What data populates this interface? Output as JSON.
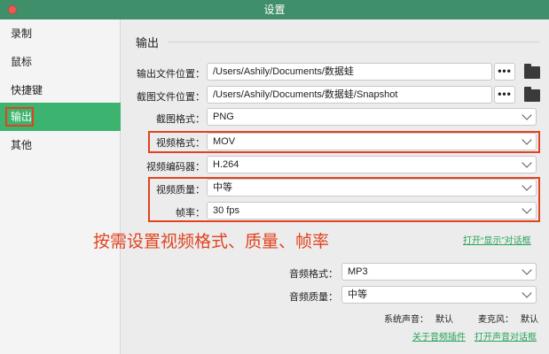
{
  "window": {
    "title": "设置"
  },
  "sidebar": {
    "items": [
      {
        "label": "录制"
      },
      {
        "label": "鼠标"
      },
      {
        "label": "快捷键"
      },
      {
        "label": "输出",
        "active": true
      },
      {
        "label": "其他"
      }
    ]
  },
  "main": {
    "section_title": "输出",
    "output_path": {
      "label": "输出文件位置：",
      "value": "/Users/Ashily/Documents/数据蛙",
      "browse": "•••"
    },
    "screenshot_path": {
      "label": "截图文件位置：",
      "value": "/Users/Ashily/Documents/数据蛙/Snapshot",
      "browse": "•••"
    },
    "screenshot_format": {
      "label": "截图格式：",
      "value": "PNG"
    },
    "video_format": {
      "label": "视频格式：",
      "value": "MOV"
    },
    "video_codec": {
      "label": "视频编码器：",
      "value": "H.264"
    },
    "video_quality": {
      "label": "视频质量：",
      "value": "中等"
    },
    "frame_rate": {
      "label": "帧率：",
      "value": "30 fps"
    },
    "annotation": "按需设置视频格式、质量、帧率",
    "open_display_dialog": "打开“显示”对话框",
    "audio_format": {
      "label": "音频格式：",
      "value": "MP3"
    },
    "audio_quality": {
      "label": "音频质量：",
      "value": "中等"
    },
    "system_sound": {
      "label": "系统声音：",
      "value": "默认"
    },
    "microphone": {
      "label": "麦克风：",
      "value": "默认"
    },
    "about_audio_plugin": "关于音频插件",
    "open_sound_dialog": "打开声音对话框"
  },
  "colors": {
    "accent": "#3cb36f",
    "titlebar": "#3f8f6a",
    "highlight": "#e0431f",
    "link": "#2aa35a"
  }
}
